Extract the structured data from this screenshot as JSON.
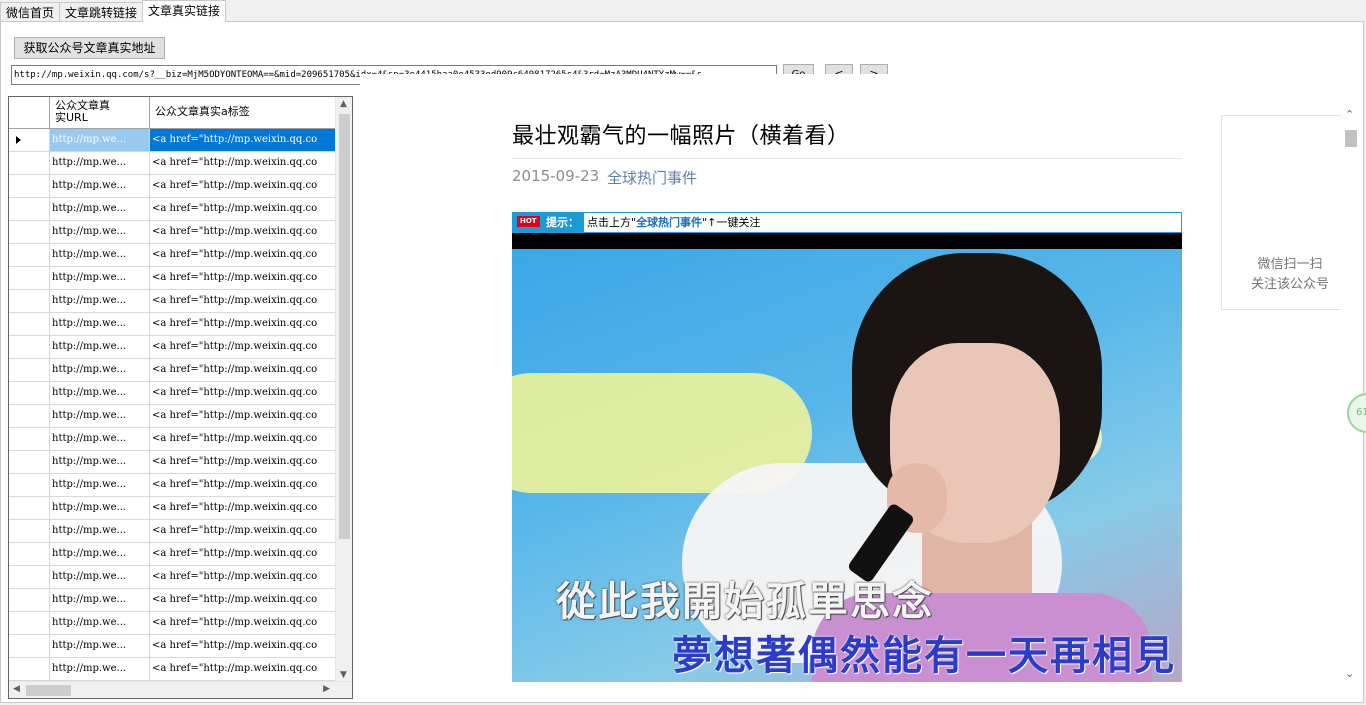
{
  "tabs": [
    {
      "label": "微信首页"
    },
    {
      "label": "文章跳转链接"
    },
    {
      "label": "文章真实链接"
    }
  ],
  "toolbar": {
    "get_button": "获取公众号文章真实地址",
    "url": "http://mp.weixin.qq.com/s?__biz=MjM5ODYONTEOMA==&mid=209651705&idx=4&sn=3e4415baa0e4533ed909c649817265c4&3rd=MzA3MDU4NTYzMw==&s",
    "go": "Go",
    "back": "<",
    "forward": ">"
  },
  "grid": {
    "columns": [
      "公众文章真实URL",
      "公众文章真实a标签"
    ],
    "col1_header_line1": "公众文章真",
    "col1_header_line2": "实URL",
    "row_url": "http://mp.we...",
    "row_tag": "<a href=\"http://mp.weixin.qq.co",
    "row_count": 24,
    "selected_row": 0
  },
  "article": {
    "title": "最壮观霸气的一幅照片（横着看）",
    "date": "2015-09-23",
    "account": "全球热门事件",
    "hot_badge": "HOT",
    "tip_label": "提示：",
    "tip_prefix": "点击上方\"",
    "tip_account": "全球热门事件",
    "tip_suffix": "\"↑一键关注",
    "subtitle_1": "從此我開始孤單思念",
    "subtitle_2": "夢想著偶然能有一天再相見",
    "qr_line1": "微信扫一扫",
    "qr_line2": "关注该公众号"
  },
  "side_badge": "61",
  "colors": {
    "selection": "#0078d7",
    "account_link": "#607fa6",
    "tip_blue": "#1a9bd6"
  }
}
